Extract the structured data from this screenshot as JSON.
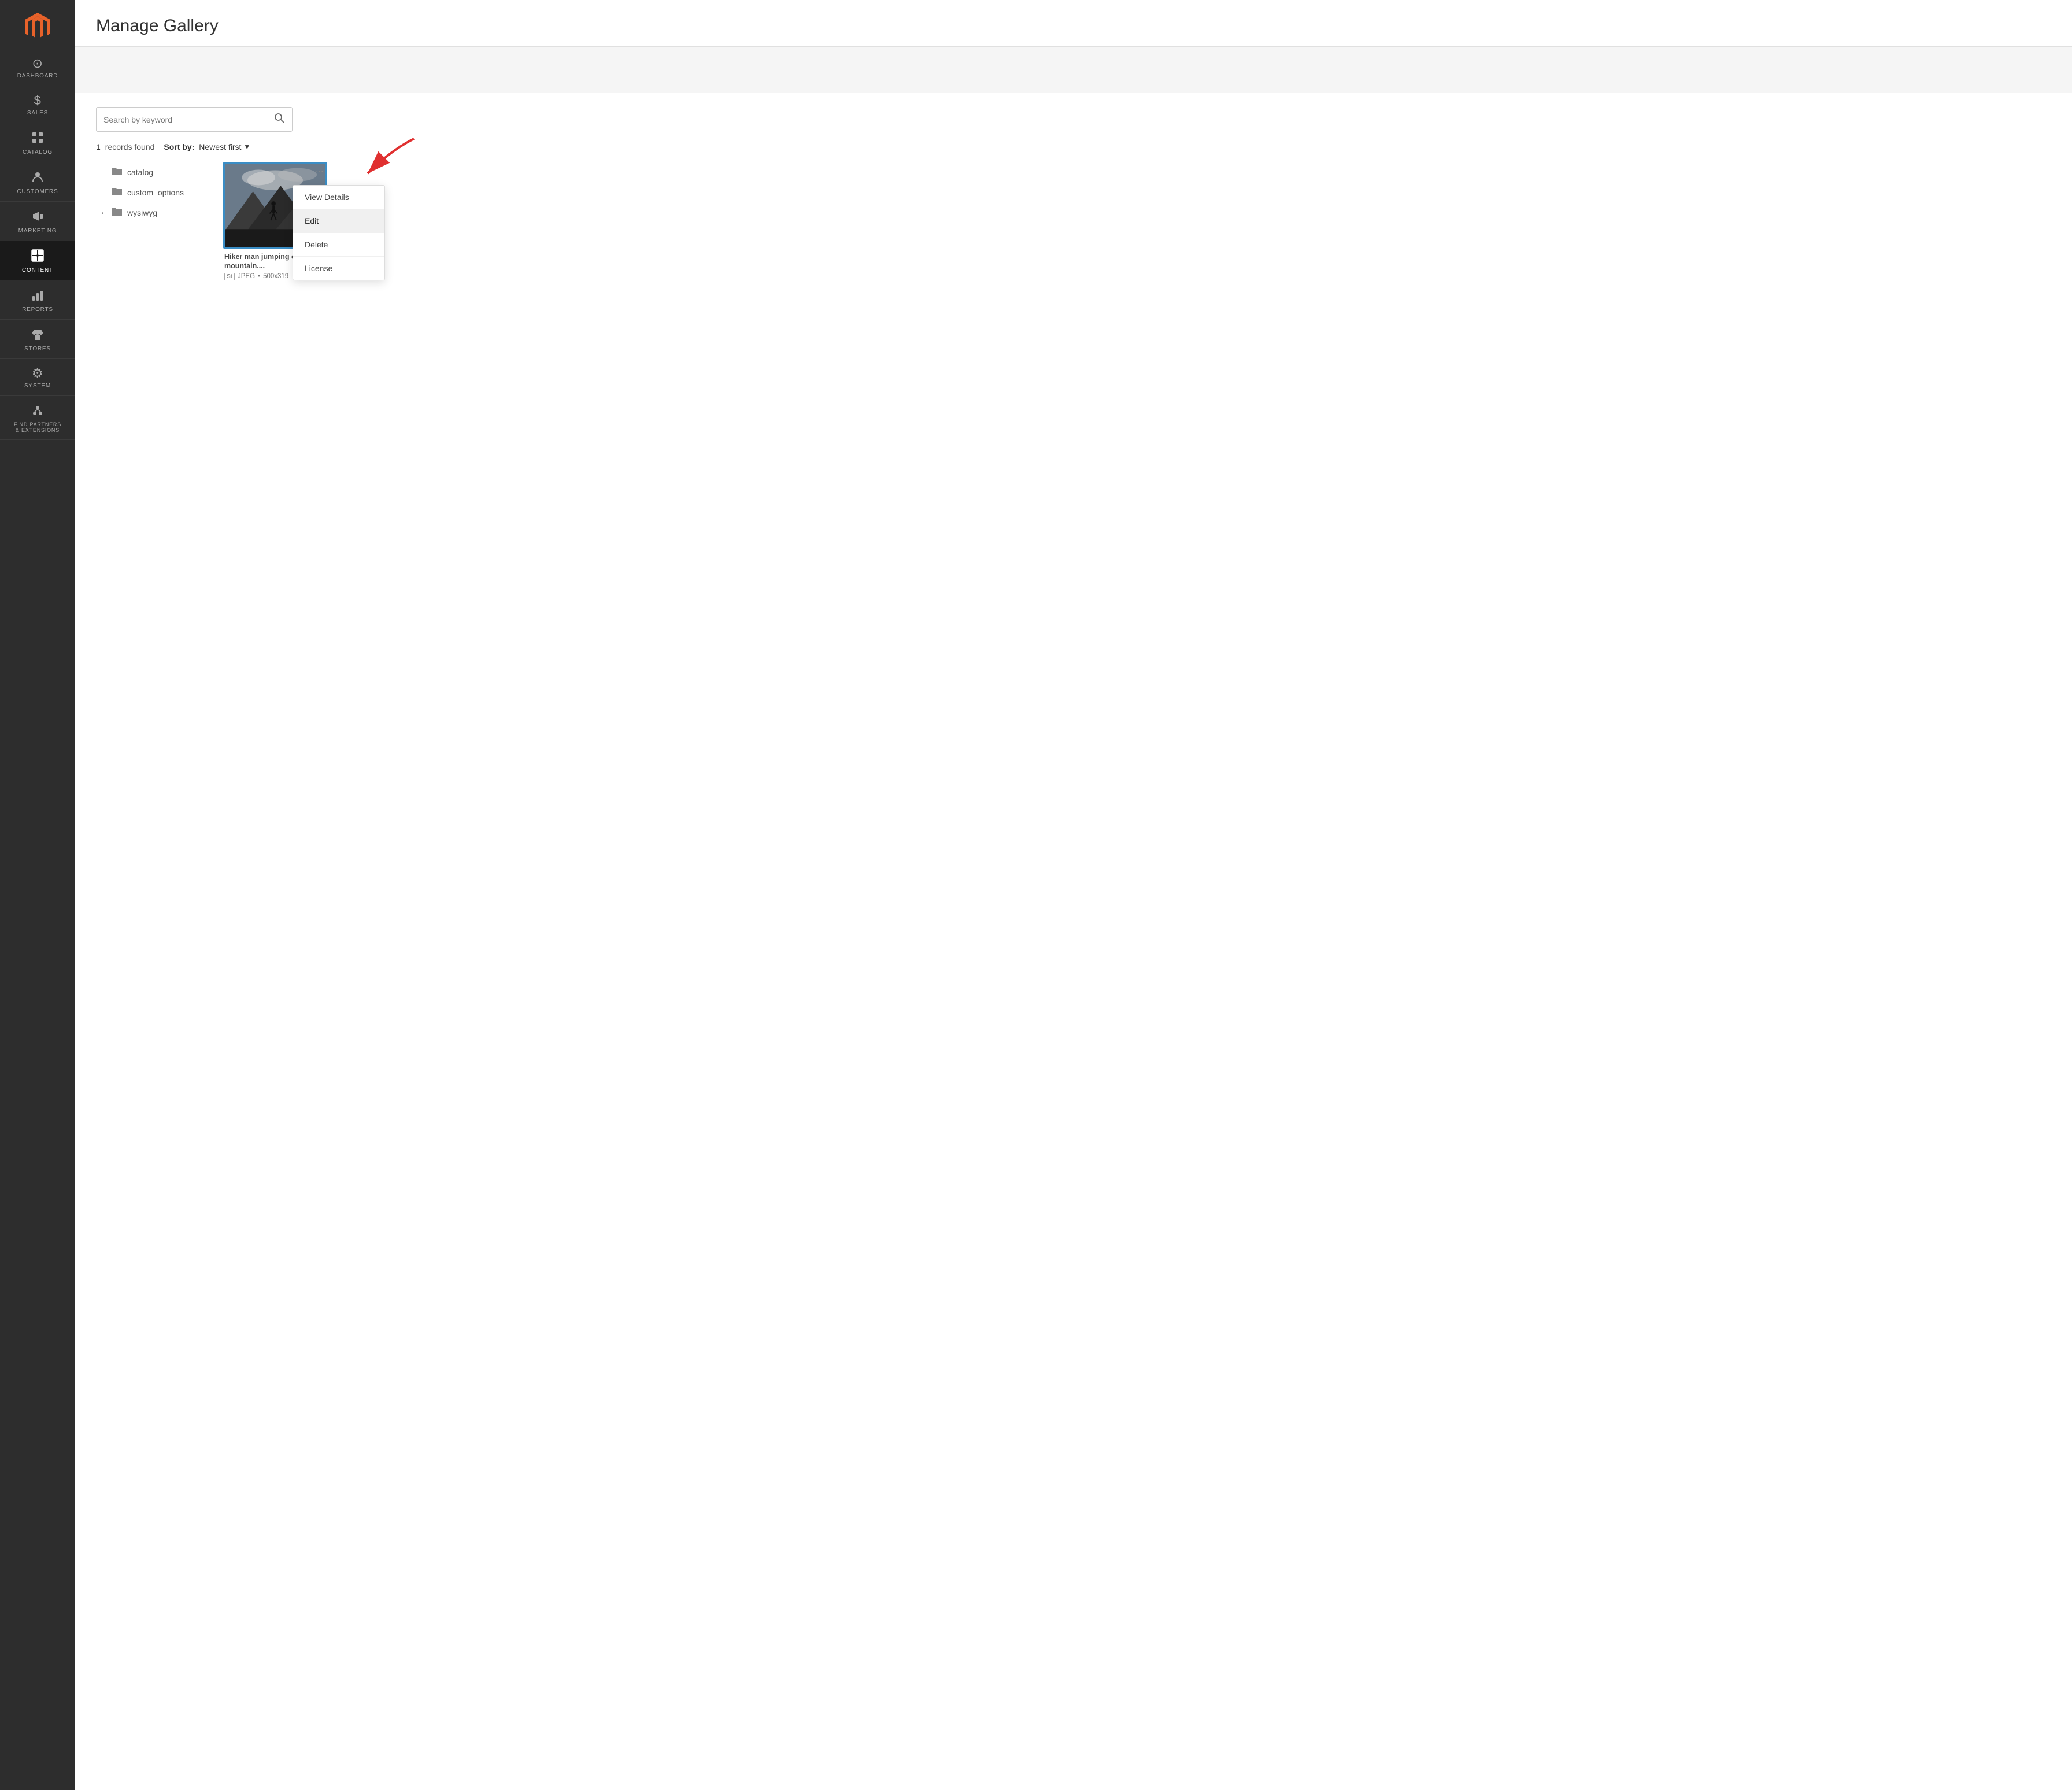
{
  "sidebar": {
    "items": [
      {
        "id": "dashboard",
        "label": "DASHBOARD",
        "icon": "⊙",
        "active": false
      },
      {
        "id": "sales",
        "label": "SALES",
        "icon": "$",
        "active": false
      },
      {
        "id": "catalog",
        "label": "CATALOG",
        "icon": "⬡",
        "active": false
      },
      {
        "id": "customers",
        "label": "CUSTOMERS",
        "icon": "👤",
        "active": false
      },
      {
        "id": "marketing",
        "label": "MARKETING",
        "icon": "📣",
        "active": false
      },
      {
        "id": "content",
        "label": "CONTENT",
        "icon": "▦",
        "active": true
      },
      {
        "id": "reports",
        "label": "REPORTS",
        "icon": "📊",
        "active": false
      },
      {
        "id": "stores",
        "label": "STORES",
        "icon": "🏪",
        "active": false
      },
      {
        "id": "system",
        "label": "SYSTEM",
        "icon": "⚙",
        "active": false
      },
      {
        "id": "partners",
        "label": "FIND PARTNERS\n& EXTENSIONS",
        "icon": "🔗",
        "active": false
      }
    ]
  },
  "page": {
    "title": "Manage Gallery"
  },
  "search": {
    "placeholder": "Search by keyword"
  },
  "records": {
    "count": "1",
    "label": "records found",
    "sort_label": "Sort by:",
    "sort_value": "Newest first"
  },
  "folders": [
    {
      "name": "catalog",
      "expandable": false,
      "indent": 0
    },
    {
      "name": "custom_options",
      "expandable": false,
      "indent": 0
    },
    {
      "name": "wysiwyg",
      "expandable": true,
      "indent": 0
    }
  ],
  "image": {
    "title": "Hiker man jumping over the mountain....",
    "format": "JPEG",
    "stock": "St",
    "dimensions": "500x319"
  },
  "context_menu": {
    "items": [
      {
        "id": "view-details",
        "label": "View Details",
        "active": false
      },
      {
        "id": "edit",
        "label": "Edit",
        "active": true
      },
      {
        "id": "delete",
        "label": "Delete",
        "active": false
      },
      {
        "id": "license",
        "label": "License",
        "active": false
      }
    ]
  }
}
